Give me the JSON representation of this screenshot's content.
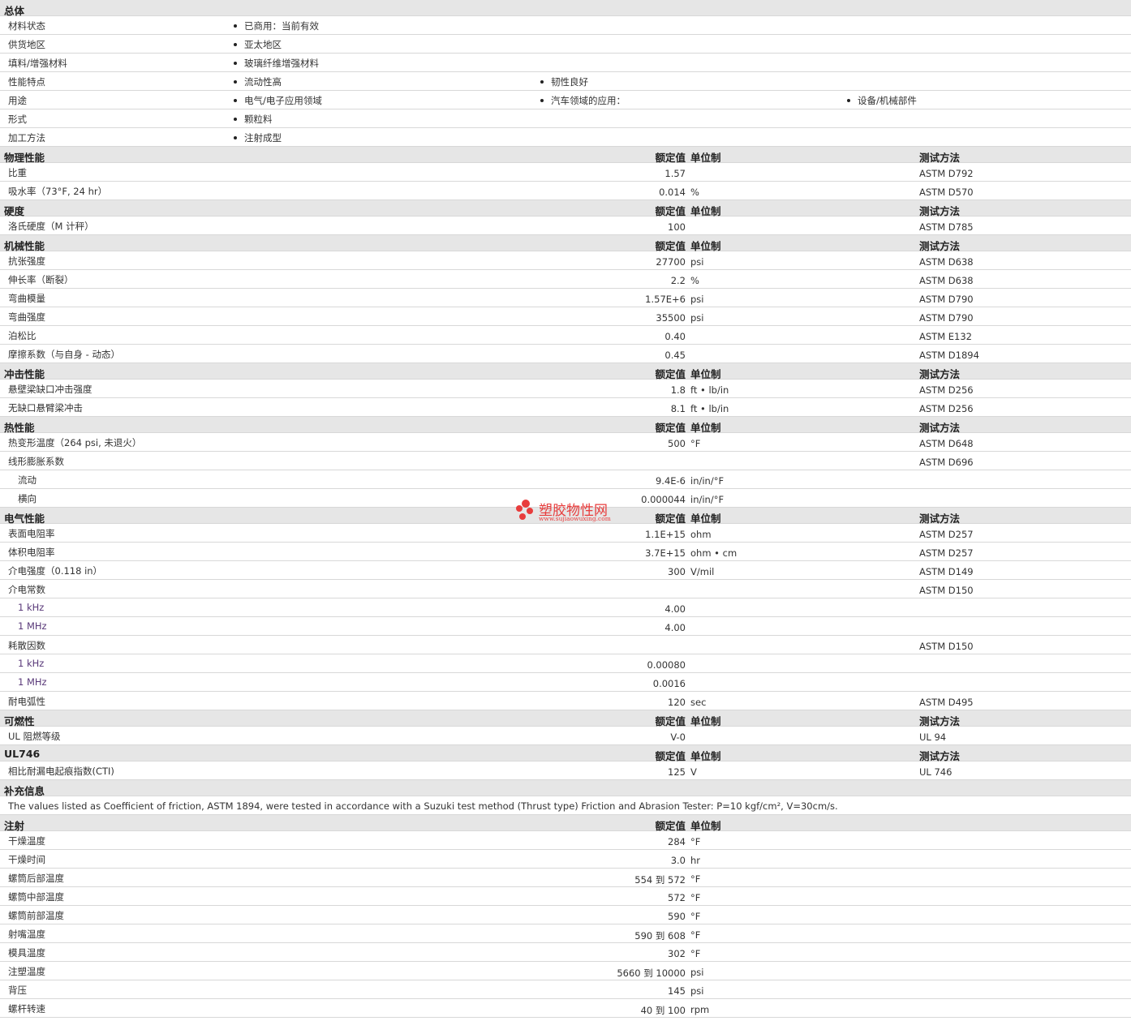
{
  "general": {
    "title": "总体",
    "rows": [
      {
        "label": "材料状态",
        "items": [
          "已商用：当前有效"
        ]
      },
      {
        "label": "供货地区",
        "items": [
          "亚太地区"
        ]
      },
      {
        "label": "填料/增强材料",
        "items": [
          "玻璃纤维增强材料"
        ]
      },
      {
        "label": "性能特点",
        "items": [
          "流动性高",
          "韧性良好"
        ]
      },
      {
        "label": "用途",
        "items": [
          "电气/电子应用领域",
          "汽车领域的应用：",
          "设备/机械部件"
        ]
      },
      {
        "label": "形式",
        "items": [
          "颗粒料"
        ]
      },
      {
        "label": "加工方法",
        "items": [
          "注射成型"
        ]
      }
    ]
  },
  "table_headers": {
    "nominal": "额定值",
    "unit": "单位制",
    "test": "测试方法"
  },
  "sections": [
    {
      "title": "物理性能",
      "rows": [
        {
          "label": "比重",
          "value": "1.57",
          "unit": "",
          "test": "ASTM D792"
        },
        {
          "label": "吸水率（73°F, 24 hr）",
          "value": "0.014",
          "unit": "%",
          "test": "ASTM D570"
        }
      ]
    },
    {
      "title": "硬度",
      "rows": [
        {
          "label": "洛氏硬度（M 计秤）",
          "value": "100",
          "unit": "",
          "test": "ASTM D785"
        }
      ]
    },
    {
      "title": "机械性能",
      "rows": [
        {
          "label": "抗张强度",
          "value": "27700",
          "unit": "psi",
          "test": "ASTM D638"
        },
        {
          "label": "伸长率（断裂）",
          "value": "2.2",
          "unit": "%",
          "test": "ASTM D638"
        },
        {
          "label": "弯曲模量",
          "value": "1.57E+6",
          "unit": "psi",
          "test": "ASTM D790"
        },
        {
          "label": "弯曲强度",
          "value": "35500",
          "unit": "psi",
          "test": "ASTM D790"
        },
        {
          "label": "泊松比",
          "value": "0.40",
          "unit": "",
          "test": "ASTM E132"
        },
        {
          "label": "摩擦系数（与自身 - 动态）",
          "value": "0.45",
          "unit": "",
          "test": "ASTM D1894"
        }
      ]
    },
    {
      "title": "冲击性能",
      "rows": [
        {
          "label": "悬壁梁缺口冲击强度",
          "value": "1.8",
          "unit": "ft • lb/in",
          "test": "ASTM D256"
        },
        {
          "label": "无缺口悬臂梁冲击",
          "value": "8.1",
          "unit": "ft • lb/in",
          "test": "ASTM D256"
        }
      ]
    },
    {
      "title": "热性能",
      "rows": [
        {
          "label": "热变形温度（264 psi, 未退火）",
          "value": "500",
          "unit": "°F",
          "test": "ASTM D648"
        },
        {
          "label": "线形膨胀系数",
          "value": "",
          "unit": "",
          "test": "ASTM D696"
        },
        {
          "label": "流动",
          "value": "9.4E-6",
          "unit": "in/in/°F",
          "test": "",
          "sub": true
        },
        {
          "label": "横向",
          "value": "0.000044",
          "unit": "in/in/°F",
          "test": "",
          "sub": true
        }
      ]
    },
    {
      "title": "电气性能",
      "rows": [
        {
          "label": "表面电阻率",
          "value": "1.1E+15",
          "unit": "ohm",
          "test": "ASTM D257"
        },
        {
          "label": "体积电阻率",
          "value": "3.7E+15",
          "unit": "ohm • cm",
          "test": "ASTM D257"
        },
        {
          "label": "介电强度（0.118 in）",
          "value": "300",
          "unit": "V/mil",
          "test": "ASTM D149"
        },
        {
          "label": "介电常数",
          "value": "",
          "unit": "",
          "test": "ASTM D150"
        },
        {
          "label": "1 kHz",
          "value": "4.00",
          "unit": "",
          "test": "",
          "sub": true,
          "purple": true
        },
        {
          "label": "1 MHz",
          "value": "4.00",
          "unit": "",
          "test": "",
          "sub": true,
          "purple": true
        },
        {
          "label": "耗散因数",
          "value": "",
          "unit": "",
          "test": "ASTM D150"
        },
        {
          "label": "1 kHz",
          "value": "0.00080",
          "unit": "",
          "test": "",
          "sub": true,
          "purple": true
        },
        {
          "label": "1 MHz",
          "value": "0.0016",
          "unit": "",
          "test": "",
          "sub": true,
          "purple": true
        },
        {
          "label": "耐电弧性",
          "value": "120",
          "unit": "sec",
          "test": "ASTM D495"
        }
      ]
    },
    {
      "title": "可燃性",
      "rows": [
        {
          "label": "UL 阻燃等级",
          "value": "V-0",
          "unit": "",
          "test": "UL 94"
        }
      ]
    },
    {
      "title": "UL746",
      "rows": [
        {
          "label": "相比耐漏电起痕指数(CTI)",
          "value": "125",
          "unit": "V",
          "test": "UL 746"
        }
      ]
    }
  ],
  "notes": {
    "title": "补充信息",
    "text": "The values listed as Coefficient of friction, ASTM 1894, were tested in accordance with a Suzuki test method (Thrust type) Friction and Abrasion Tester: P=10 kgf/cm², V=30cm/s."
  },
  "injection": {
    "title": "注射",
    "rows": [
      {
        "label": "干燥温度",
        "value": "284",
        "unit": "°F"
      },
      {
        "label": "干燥时间",
        "value": "3.0",
        "unit": "hr"
      },
      {
        "label": "螺筒后部温度",
        "value": "554 到 572",
        "unit": "°F"
      },
      {
        "label": "螺筒中部温度",
        "value": "572",
        "unit": "°F"
      },
      {
        "label": "螺筒前部温度",
        "value": "590",
        "unit": "°F"
      },
      {
        "label": "射嘴温度",
        "value": "590 到 608",
        "unit": "°F"
      },
      {
        "label": "模具温度",
        "value": "302",
        "unit": "°F"
      },
      {
        "label": "注塑温度",
        "value": "5660 到 10000",
        "unit": "psi"
      },
      {
        "label": "背压",
        "value": "145",
        "unit": "psi"
      },
      {
        "label": "螺杆转速",
        "value": "40 到 100",
        "unit": "rpm"
      }
    ]
  },
  "watermark": {
    "text": "塑胶物性网",
    "url": "www.sujiaowuxing.com",
    "color": "#e83c3c"
  }
}
